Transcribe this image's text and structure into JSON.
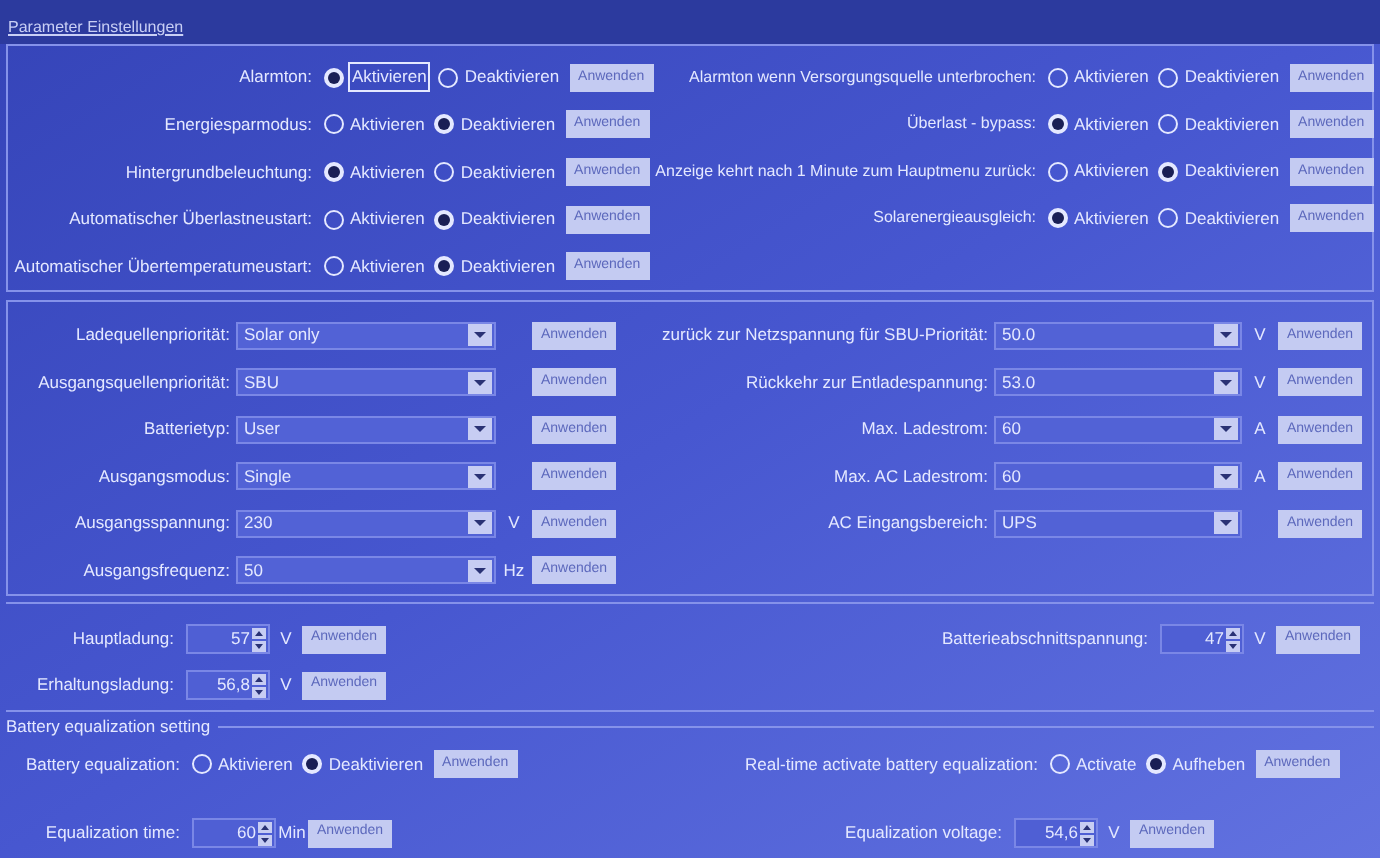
{
  "panel_title": "Parameter Einstellungen",
  "toggles_left": [
    {
      "label": "Alarmton:",
      "options": [
        {
          "label": "Aktivieren",
          "selected": true
        },
        {
          "label": "Deaktivieren",
          "selected": false
        }
      ],
      "button": {
        "label": "Anwenden",
        "disabled": true
      }
    },
    {
      "label": "Energiesparmodus:",
      "options": [
        {
          "label": "Aktivieren",
          "selected": false
        },
        {
          "label": "Deaktivieren",
          "selected": true
        }
      ],
      "button": {
        "label": "Anwenden",
        "disabled": true
      }
    },
    {
      "label": "Hintergrundbeleuchtung:",
      "options": [
        {
          "label": "Aktivieren",
          "selected": true
        },
        {
          "label": "Deaktivieren",
          "selected": false
        }
      ],
      "button": {
        "label": "Anwenden",
        "disabled": true
      }
    },
    {
      "label": "Automatischer Überlastneustart:",
      "options": [
        {
          "label": "Aktivieren",
          "selected": false
        },
        {
          "label": "Deaktivieren",
          "selected": true
        }
      ],
      "button": {
        "label": "Anwenden",
        "disabled": true
      }
    },
    {
      "label": "Automatischer Übertemperatumeustart:",
      "options": [
        {
          "label": "Aktivieren",
          "selected": false
        },
        {
          "label": "Deaktivieren",
          "selected": true
        }
      ],
      "button": {
        "label": "Anwenden",
        "disabled": true
      }
    }
  ],
  "toggles_right": [
    {
      "label": "Alarmton wenn Versorgungsquelle unterbrochen:",
      "options": [
        {
          "label": "Aktivieren",
          "selected": false
        },
        {
          "label": "Deaktivieren",
          "selected": false
        }
      ],
      "button": {
        "label": "Anwenden",
        "disabled": true
      }
    },
    {
      "label": "Überlast - bypass:",
      "options": [
        {
          "label": "Aktivieren",
          "selected": true
        },
        {
          "label": "Deaktivieren",
          "selected": false
        }
      ],
      "button": {
        "label": "Anwenden",
        "disabled": true
      }
    },
    {
      "label": "Anzeige kehrt nach 1 Minute zum Hauptmenu zurück:",
      "options": [
        {
          "label": "Aktivieren",
          "selected": false
        },
        {
          "label": "Deaktivieren",
          "selected": true
        }
      ],
      "button": {
        "label": "Anwenden",
        "disabled": true
      }
    },
    {
      "label": "Solarenergieausgleich:",
      "options": [
        {
          "label": "Aktivieren",
          "selected": true
        },
        {
          "label": "Deaktivieren",
          "selected": false
        }
      ],
      "button": {
        "label": "Anwenden",
        "disabled": true
      }
    }
  ],
  "selects_left": [
    {
      "label": "Ladequellenpriorität:",
      "value": "Solar only",
      "button": {
        "label": "Anwenden",
        "disabled": true
      }
    },
    {
      "label": "Ausgangsquellenpriorität:",
      "value": "SBU",
      "button": {
        "label": "Anwenden",
        "disabled": true
      }
    },
    {
      "label": "Batterietyp:",
      "value": "User",
      "button": {
        "label": "Anwenden",
        "disabled": true
      }
    },
    {
      "label": "Ausgangsmodus:",
      "value": "Single",
      "button": {
        "label": "Anwenden",
        "disabled": true
      }
    },
    {
      "label": "Ausgangsspannung:",
      "value": "230",
      "unit": "V",
      "button": {
        "label": "Anwenden",
        "disabled": true
      }
    },
    {
      "label": "Ausgangsfrequenz:",
      "value": "50",
      "unit": "Hz",
      "button": {
        "label": "Anwenden",
        "disabled": true
      }
    }
  ],
  "selects_right": [
    {
      "label": "zurück zur Netzspannung für SBU-Priorität:",
      "value": "50.0",
      "unit": "V",
      "button": {
        "label": "Anwenden",
        "disabled": true
      }
    },
    {
      "label": "Rückkehr zur Entladespannung:",
      "value": "53.0",
      "unit": "V",
      "button": {
        "label": "Anwenden",
        "disabled": true
      }
    },
    {
      "label": "Max. Ladestrom:",
      "value": "60",
      "unit": "A",
      "button": {
        "label": "Anwenden",
        "disabled": true
      }
    },
    {
      "label": "Max. AC Ladestrom:",
      "value": "60",
      "unit": "A",
      "button": {
        "label": "Anwenden",
        "disabled": true
      }
    },
    {
      "label": "AC Eingangsbereich:",
      "value": "UPS",
      "button": {
        "label": "Anwenden",
        "disabled": true
      }
    }
  ],
  "spinners_left": [
    {
      "label": "Hauptladung:",
      "value": "57",
      "unit": "V",
      "button": {
        "label": "Anwenden",
        "disabled": true
      }
    },
    {
      "label": "Erhaltungsladung:",
      "value": "56,8",
      "unit": "V",
      "button": {
        "label": "Anwenden",
        "disabled": true
      }
    }
  ],
  "spinners_right": [
    {
      "label": "Batterieabschnittspannung:",
      "value": "47",
      "unit": "V",
      "button": {
        "label": "Anwenden",
        "disabled": true
      }
    }
  ],
  "equalization": {
    "title": "Battery equalization setting",
    "toggle_left": {
      "label": "Battery equalization:",
      "options": [
        {
          "label": "Aktivieren",
          "selected": false
        },
        {
          "label": "Deaktivieren",
          "selected": true
        }
      ],
      "button": {
        "label": "Anwenden",
        "disabled": true
      }
    },
    "toggle_right": {
      "label": "Real-time activate battery equalization:",
      "options": [
        {
          "label": "Activate",
          "selected": false
        },
        {
          "label": "Aufheben",
          "selected": true
        }
      ],
      "button": {
        "label": "Anwenden",
        "disabled": true
      }
    },
    "spinner_left": {
      "label": "Equalization time:",
      "value": "60",
      "unit": "Min",
      "button": {
        "label": "Anwenden",
        "disabled": true
      }
    },
    "spinner_right": {
      "label": "Equalization voltage:",
      "value": "54,6",
      "unit": "V",
      "button": {
        "label": "Anwenden",
        "disabled": true
      }
    }
  }
}
